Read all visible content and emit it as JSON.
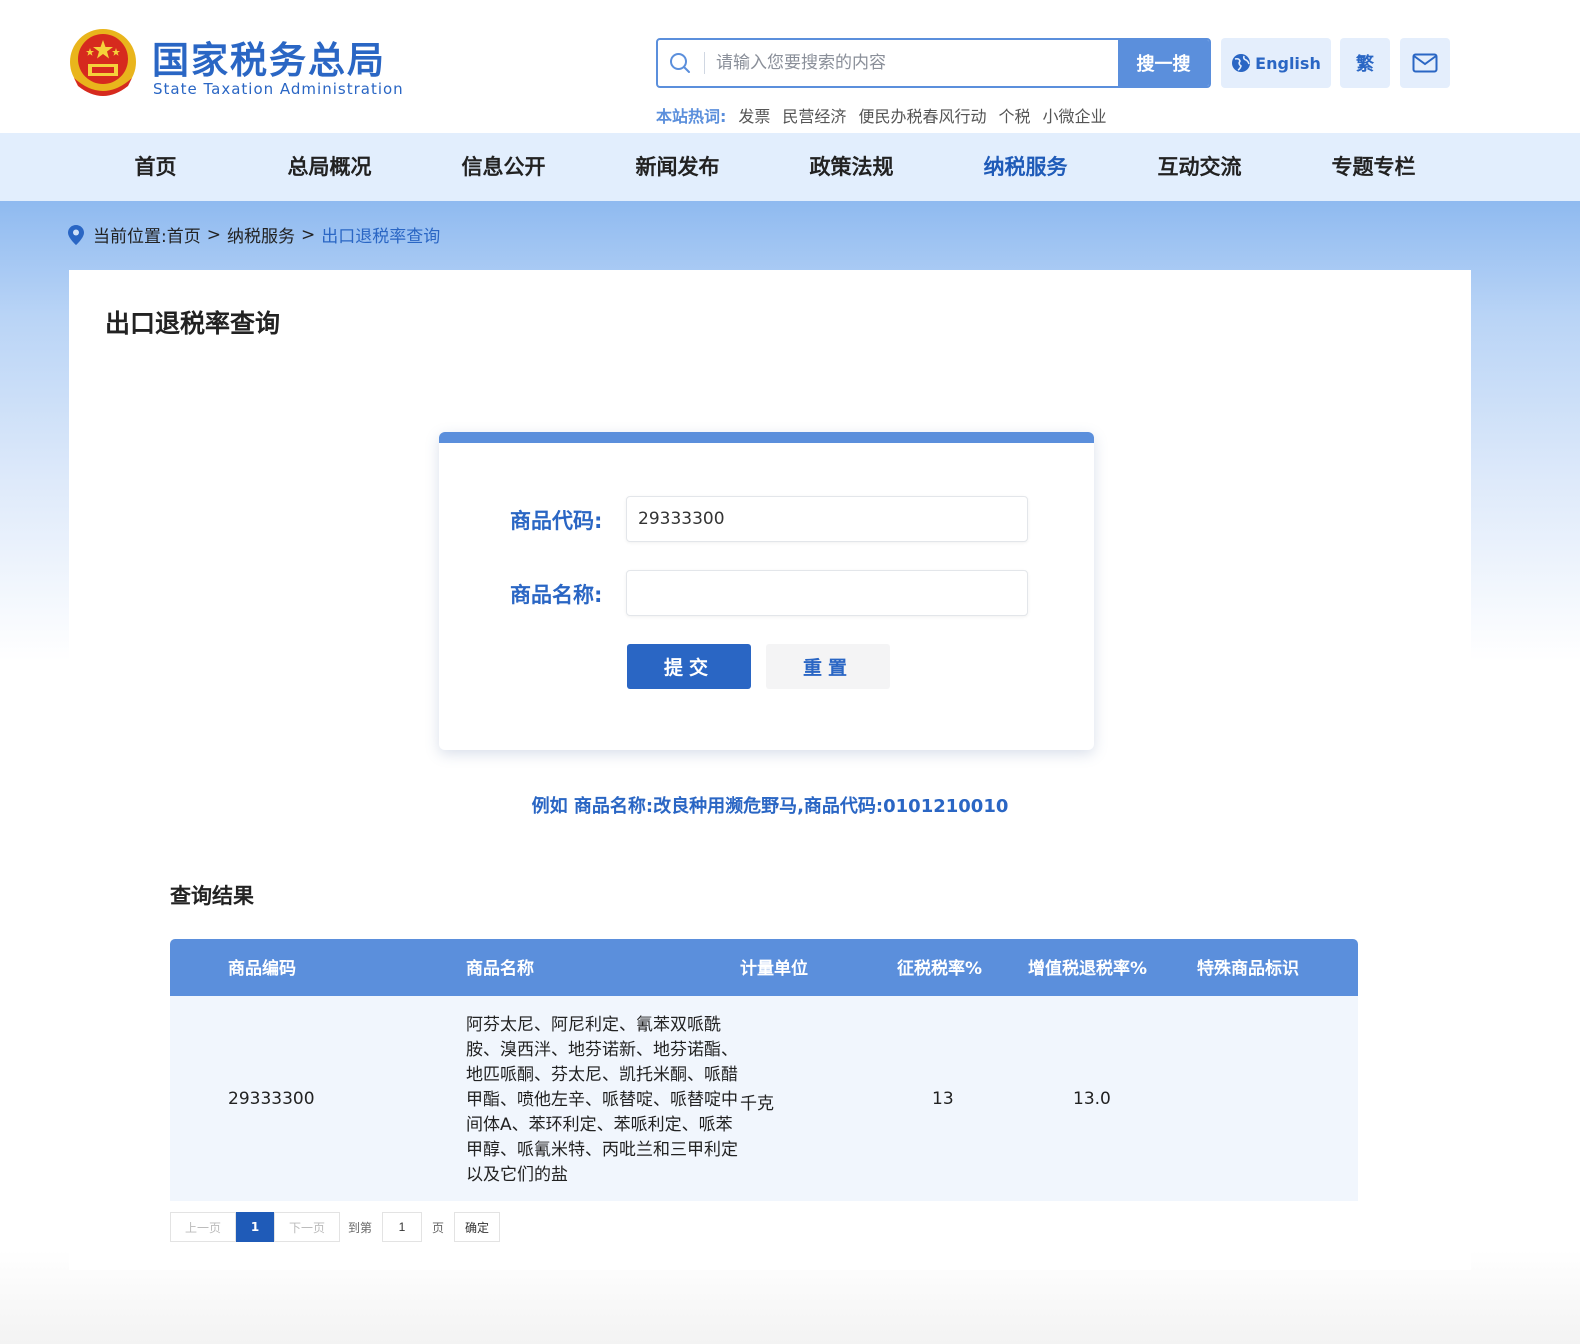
{
  "header": {
    "logo_cn": "国家税务总局",
    "logo_en": "State Taxation Administration",
    "search_placeholder": "请输入您要搜索的内容",
    "search_button": "搜一搜",
    "english_label": "English",
    "traditional_label": "繁",
    "hot_label": "本站热词:",
    "hot_words": [
      "发票",
      "民营经济",
      "便民办税春风行动",
      "个税",
      "小微企业"
    ]
  },
  "nav": {
    "items": [
      "首页",
      "总局概况",
      "信息公开",
      "新闻发布",
      "政策法规",
      "纳税服务",
      "互动交流",
      "专题专栏"
    ],
    "active": "纳税服务"
  },
  "breadcrumb": {
    "prefix": "当前位置:",
    "home": "首页",
    "parent": "纳税服务",
    "current": "出口退税率查询",
    "separator": ">"
  },
  "page": {
    "title": "出口退税率查询",
    "form": {
      "code_label": "商品代码:",
      "code_value": "29333300",
      "name_label": "商品名称:",
      "name_value": "",
      "submit_label": "提交",
      "reset_label": "重置"
    },
    "example": "例如 商品名称:改良种用濒危野马,商品代码:0101210010",
    "result_title": "查询结果"
  },
  "table": {
    "columns": [
      "商品编码",
      "商品名称",
      "计量单位",
      "征税税率%",
      "增值税退税率%",
      "特殊商品标识"
    ],
    "rows": [
      {
        "code": "29333300",
        "name": "阿芬太尼、阿尼利定、氰苯双哌酰胺、溴西泮、地芬诺新、地芬诺酯、地匹哌酮、芬太尼、凯托米酮、哌醋甲酯、喷他左辛、哌替啶、哌替啶中间体A、苯环利定、苯哌利定、哌苯甲醇、哌氰米特、丙吡兰和三甲利定以及它们的盐",
        "unit": "千克",
        "tax_rate": "13",
        "refund_rate": "13.0",
        "special_flag": ""
      }
    ]
  },
  "pager": {
    "prev": "上一页",
    "current_page": "1",
    "next": "下一页",
    "goto_label": "到第",
    "goto_value": "1",
    "page_unit": "页",
    "confirm": "确定"
  },
  "colors": {
    "brand_blue": "#2a66c4",
    "accent_blue": "#5b8fdc",
    "nav_bg": "#e2eefd",
    "row_bg": "#f1f6fd"
  }
}
